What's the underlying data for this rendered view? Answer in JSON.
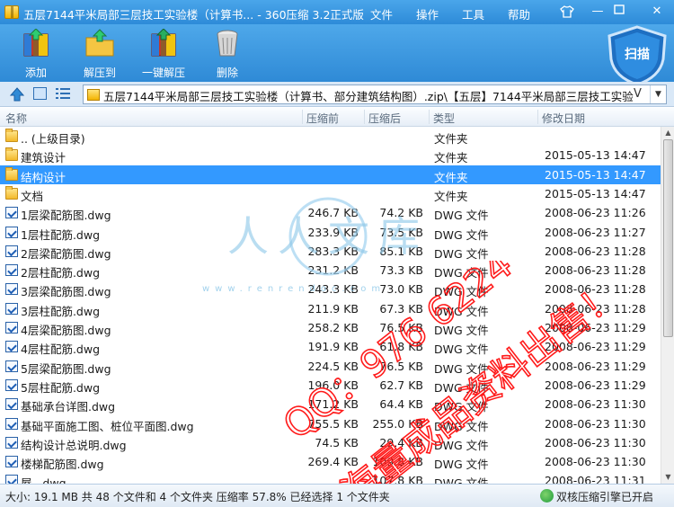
{
  "window": {
    "title": "五层7144平米局部三层技工实验楼（计算书... - 360压缩 3.2正式版",
    "menus": [
      "文件",
      "操作",
      "工具",
      "帮助"
    ],
    "shirt_icon": "tshirt-icon"
  },
  "toolbar": {
    "buttons": [
      {
        "label": "添加",
        "icon": "add-archive-icon"
      },
      {
        "label": "解压到",
        "icon": "extract-to-icon"
      },
      {
        "label": "一键解压",
        "icon": "one-click-extract-icon"
      },
      {
        "label": "删除",
        "icon": "trash-icon"
      }
    ],
    "scan_label": "扫描"
  },
  "address": {
    "path": "五层7144平米局部三层技工实验楼（计算书、部分建筑结构图）.zip\\【五层】7144平米局部三层技工实验楼",
    "v_label": "V"
  },
  "columns": {
    "name": "名称",
    "size": "压缩前",
    "compressed": "压缩后",
    "type": "类型",
    "modified": "修改日期"
  },
  "rows": [
    {
      "kind": "folder",
      "name": ".. (上级目录)",
      "size": "",
      "compressed": "",
      "type": "文件夹",
      "date": ""
    },
    {
      "kind": "folder",
      "name": "建筑设计",
      "size": "",
      "compressed": "",
      "type": "文件夹",
      "date": "2015-05-13 14:47"
    },
    {
      "kind": "folder",
      "name": "结构设计",
      "size": "",
      "compressed": "",
      "type": "文件夹",
      "date": "2015-05-13 14:47",
      "selected": true
    },
    {
      "kind": "folder",
      "name": "文档",
      "size": "",
      "compressed": "",
      "type": "文件夹",
      "date": "2015-05-13 14:47"
    },
    {
      "kind": "dwg",
      "name": "1层梁配筋图.dwg",
      "size": "246.7 KB",
      "compressed": "74.2 KB",
      "type": "DWG 文件",
      "date": "2008-06-23 11:26"
    },
    {
      "kind": "dwg",
      "name": "1层柱配筋.dwg",
      "size": "233.9 KB",
      "compressed": "73.5 KB",
      "type": "DWG 文件",
      "date": "2008-06-23 11:27"
    },
    {
      "kind": "dwg",
      "name": "2层梁配筋图.dwg",
      "size": "283.3 KB",
      "compressed": "85.1 KB",
      "type": "DWG 文件",
      "date": "2008-06-23 11:28"
    },
    {
      "kind": "dwg",
      "name": "2层柱配筋.dwg",
      "size": "231.2 KB",
      "compressed": "73.3 KB",
      "type": "DWG 文件",
      "date": "2008-06-23 11:28"
    },
    {
      "kind": "dwg",
      "name": "3层梁配筋图.dwg",
      "size": "243.3 KB",
      "compressed": "73.0 KB",
      "type": "DWG 文件",
      "date": "2008-06-23 11:28"
    },
    {
      "kind": "dwg",
      "name": "3层柱配筋.dwg",
      "size": "211.9 KB",
      "compressed": "67.3 KB",
      "type": "DWG 文件",
      "date": "2008-06-23 11:28"
    },
    {
      "kind": "dwg",
      "name": "4层梁配筋图.dwg",
      "size": "258.2 KB",
      "compressed": "76.5 KB",
      "type": "DWG 文件",
      "date": "2008-06-23 11:29"
    },
    {
      "kind": "dwg",
      "name": "4层柱配筋.dwg",
      "size": "191.9 KB",
      "compressed": "61.8 KB",
      "type": "DWG 文件",
      "date": "2008-06-23 11:29"
    },
    {
      "kind": "dwg",
      "name": "5层梁配筋图.dwg",
      "size": "224.5 KB",
      "compressed": "76.5 KB",
      "type": "DWG 文件",
      "date": "2008-06-23 11:29"
    },
    {
      "kind": "dwg",
      "name": "5层柱配筋.dwg",
      "size": "196.0 KB",
      "compressed": "62.7 KB",
      "type": "DWG 文件",
      "date": "2008-06-23 11:29"
    },
    {
      "kind": "dwg",
      "name": "基础承台详图.dwg",
      "size": "171.2 KB",
      "compressed": "64.4 KB",
      "type": "DWG 文件",
      "date": "2008-06-23 11:30"
    },
    {
      "kind": "dwg",
      "name": "基础平面施工图、桩位平面图.dwg",
      "size": "755.5 KB",
      "compressed": "255.0 KB",
      "type": "DWG 文件",
      "date": "2008-06-23 11:30"
    },
    {
      "kind": "dwg",
      "name": "结构设计总说明.dwg",
      "size": "74.5 KB",
      "compressed": "29.4 KB",
      "type": "DWG 文件",
      "date": "2008-06-23 11:30"
    },
    {
      "kind": "dwg",
      "name": "楼梯配筋图.dwg",
      "size": "269.4 KB",
      "compressed": "109.8 KB",
      "type": "DWG 文件",
      "date": "2008-06-23 11:30"
    },
    {
      "kind": "dwg",
      "name": "屋...dwg",
      "size": "",
      "compressed": "107.8 KB",
      "type": "DWG 文件",
      "date": "2008-06-23 11:31"
    }
  ],
  "status": {
    "left": "大小: 19.1 MB 共 48 个文件和 4 个文件夹 压缩率 57.8% 已经选择 1 个文件夹",
    "right": "双核压缩引擎已开启"
  },
  "watermark": {
    "logo_text": "人人文库",
    "url_text": "www.renrendoc.com",
    "red_line1": "QQ：976 6224",
    "red_line2": "海量成品资料出售！"
  }
}
